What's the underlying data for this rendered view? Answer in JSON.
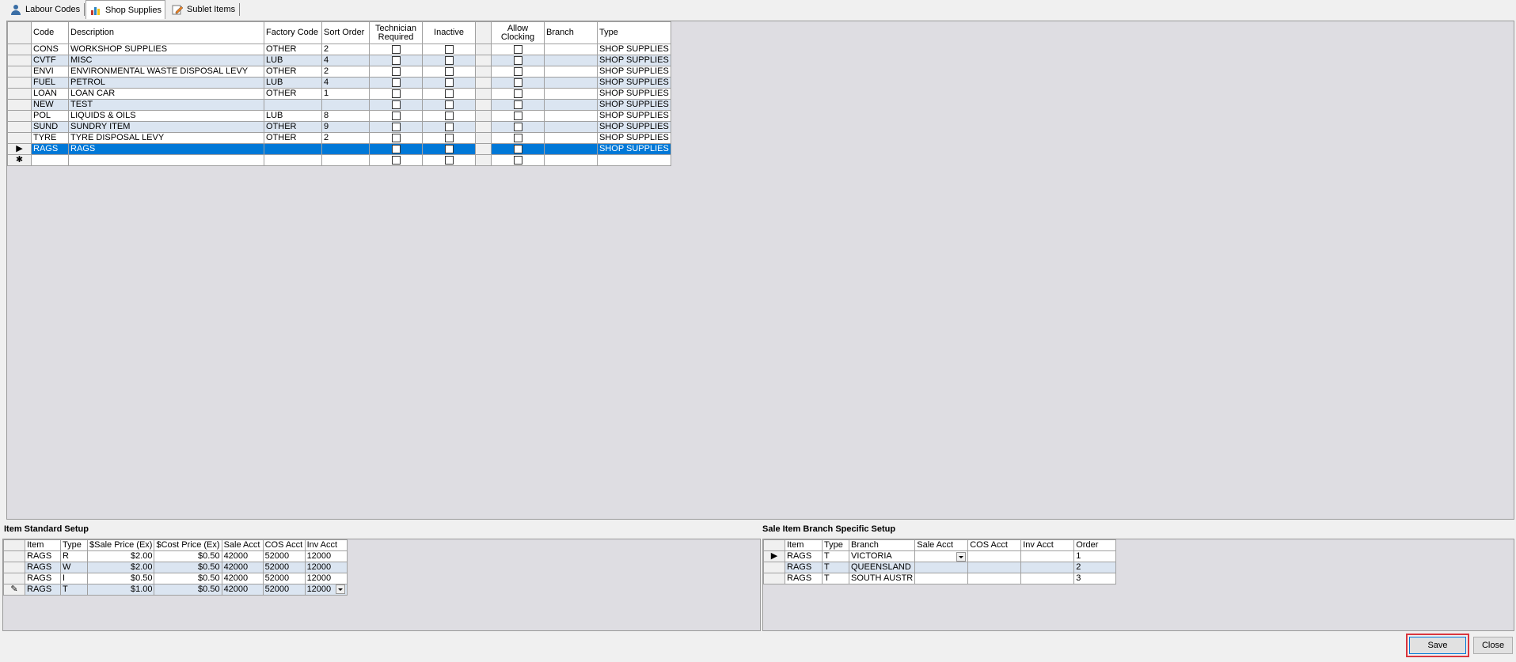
{
  "tabs": [
    {
      "label": "Labour Codes",
      "icon": "person-icon"
    },
    {
      "label": "Shop Supplies",
      "icon": "chart-icon"
    },
    {
      "label": "Sublet Items",
      "icon": "pencil-icon"
    }
  ],
  "main_grid": {
    "headers": {
      "code": "Code",
      "description": "Description",
      "factory_code": "Factory Code",
      "sort_order": "Sort Order",
      "technician_required": "Technician Required",
      "inactive": "Inactive",
      "allow_clocking": "Allow Clocking",
      "branch": "Branch",
      "type": "Type"
    },
    "rows": [
      {
        "code": "CONS",
        "description": "WORKSHOP SUPPLIES",
        "factory_code": "OTHER",
        "sort_order": "2",
        "branch": "",
        "type": "SHOP SUPPLIES"
      },
      {
        "code": "CVTF",
        "description": "MISC",
        "factory_code": "LUB",
        "sort_order": "4",
        "branch": "",
        "type": "SHOP SUPPLIES"
      },
      {
        "code": "ENVI",
        "description": "ENVIRONMENTAL WASTE DISPOSAL LEVY",
        "factory_code": "OTHER",
        "sort_order": "2",
        "branch": "",
        "type": "SHOP SUPPLIES"
      },
      {
        "code": "FUEL",
        "description": "PETROL",
        "factory_code": "LUB",
        "sort_order": "4",
        "branch": "",
        "type": "SHOP SUPPLIES"
      },
      {
        "code": "LOAN",
        "description": "LOAN CAR",
        "factory_code": "OTHER",
        "sort_order": "1",
        "branch": "",
        "type": "SHOP SUPPLIES"
      },
      {
        "code": "NEW",
        "description": "TEST",
        "factory_code": "",
        "sort_order": "",
        "branch": "",
        "type": "SHOP SUPPLIES"
      },
      {
        "code": "POL",
        "description": "LIQUIDS & OILS",
        "factory_code": "LUB",
        "sort_order": "8",
        "branch": "",
        "type": "SHOP SUPPLIES"
      },
      {
        "code": "SUND",
        "description": "SUNDRY ITEM",
        "factory_code": "OTHER",
        "sort_order": "9",
        "branch": "",
        "type": "SHOP SUPPLIES"
      },
      {
        "code": "TYRE",
        "description": "TYRE DISPOSAL LEVY",
        "factory_code": "OTHER",
        "sort_order": "2",
        "branch": "",
        "type": "SHOP SUPPLIES"
      },
      {
        "code": "RAGS",
        "description": "RAGS",
        "factory_code": "",
        "sort_order": "",
        "branch": "",
        "type": "SHOP SUPPLIES"
      }
    ]
  },
  "item_standard_setup": {
    "label": "Item Standard Setup",
    "headers": {
      "item": "Item",
      "type": "Type",
      "sale_price": "$Sale Price (Ex)",
      "cost_price": "$Cost Price (Ex)",
      "sale_acct": "Sale Acct",
      "cos_acct": "COS Acct",
      "inv_acct": "Inv Acct"
    },
    "rows": [
      {
        "item": "RAGS",
        "type": "R",
        "sale_price": "$2.00",
        "cost_price": "$0.50",
        "sale_acct": "42000",
        "cos_acct": "52000",
        "inv_acct": "12000"
      },
      {
        "item": "RAGS",
        "type": "W",
        "sale_price": "$2.00",
        "cost_price": "$0.50",
        "sale_acct": "42000",
        "cos_acct": "52000",
        "inv_acct": "12000"
      },
      {
        "item": "RAGS",
        "type": "I",
        "sale_price": "$0.50",
        "cost_price": "$0.50",
        "sale_acct": "42000",
        "cos_acct": "52000",
        "inv_acct": "12000"
      },
      {
        "item": "RAGS",
        "type": "T",
        "sale_price": "$1.00",
        "cost_price": "$0.50",
        "sale_acct": "42000",
        "cos_acct": "52000",
        "inv_acct": "12000"
      }
    ]
  },
  "branch_setup": {
    "label": "Sale Item Branch Specific Setup",
    "headers": {
      "item": "Item",
      "type": "Type",
      "branch": "Branch",
      "sale_acct": "Sale Acct",
      "cos_acct": "COS Acct",
      "inv_acct": "Inv Acct",
      "order": "Order"
    },
    "rows": [
      {
        "item": "RAGS",
        "type": "T",
        "branch": "VICTORIA",
        "sale_acct": "",
        "cos_acct": "",
        "inv_acct": "",
        "order": "1"
      },
      {
        "item": "RAGS",
        "type": "T",
        "branch": "QUEENSLAND",
        "sale_acct": "",
        "cos_acct": "",
        "inv_acct": "",
        "order": "2"
      },
      {
        "item": "RAGS",
        "type": "T",
        "branch": "SOUTH AUSTR",
        "sale_acct": "",
        "cos_acct": "",
        "inv_acct": "",
        "order": "3"
      }
    ]
  },
  "buttons": {
    "save": "Save",
    "close": "Close"
  },
  "colors": {
    "selection": "#0078d7",
    "alt_row": "#dbe5f1",
    "grid_bg": "#dedde2",
    "save_highlight": "#d9363e"
  }
}
